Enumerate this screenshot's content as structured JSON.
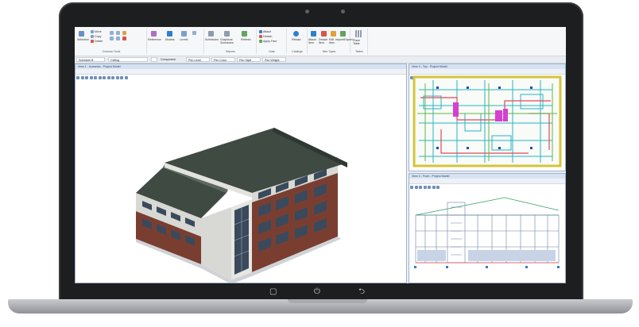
{
  "ribbon": {
    "groups": [
      {
        "caption": "Common Tools",
        "items": [
          "Selection",
          "Move",
          "Copy",
          "Delete"
        ]
      },
      {
        "caption": "",
        "items": [
          "Reference",
          "Models",
          "Levels"
        ]
      },
      {
        "caption": "Reports",
        "items": [
          "Schedules",
          "Graphical Schedules",
          "Refresh"
        ]
      },
      {
        "caption": "Data",
        "items": [
          "Attach",
          "Detach",
          "Apply Fast"
        ]
      },
      {
        "caption": "Catalogs",
        "items": [
          "Reload"
        ]
      },
      {
        "caption": "Item Types",
        "items": [
          "Attach Item",
          "Detach Item",
          "Edit Item",
          "Import/Export"
        ]
      },
      {
        "caption": "Tables",
        "items": [
          "Place Table"
        ]
      }
    ]
  },
  "attributes": {
    "scheduler": "Schedule B",
    "level": "Ceiling",
    "component_label": "Component",
    "pen_level": "Pen Level",
    "pen_color": "Pen Color",
    "pen_style": "Pen Style",
    "pen_weight": "Pen Weight"
  },
  "views": {
    "main_title": "View 1 - Isometric - Project Model",
    "plan_title": "View 2 - Top - Project Model",
    "elevation_title": "View 3 - Front - Project Model"
  },
  "device": {
    "bottom_icons": [
      "recent-apps-icon",
      "power-icon",
      "back-icon"
    ]
  },
  "colors": {
    "roof": "#3f4a43",
    "brick": "#7a3e31",
    "glass": "#3a4a5c",
    "panel_accent": "#2f7fd0"
  }
}
